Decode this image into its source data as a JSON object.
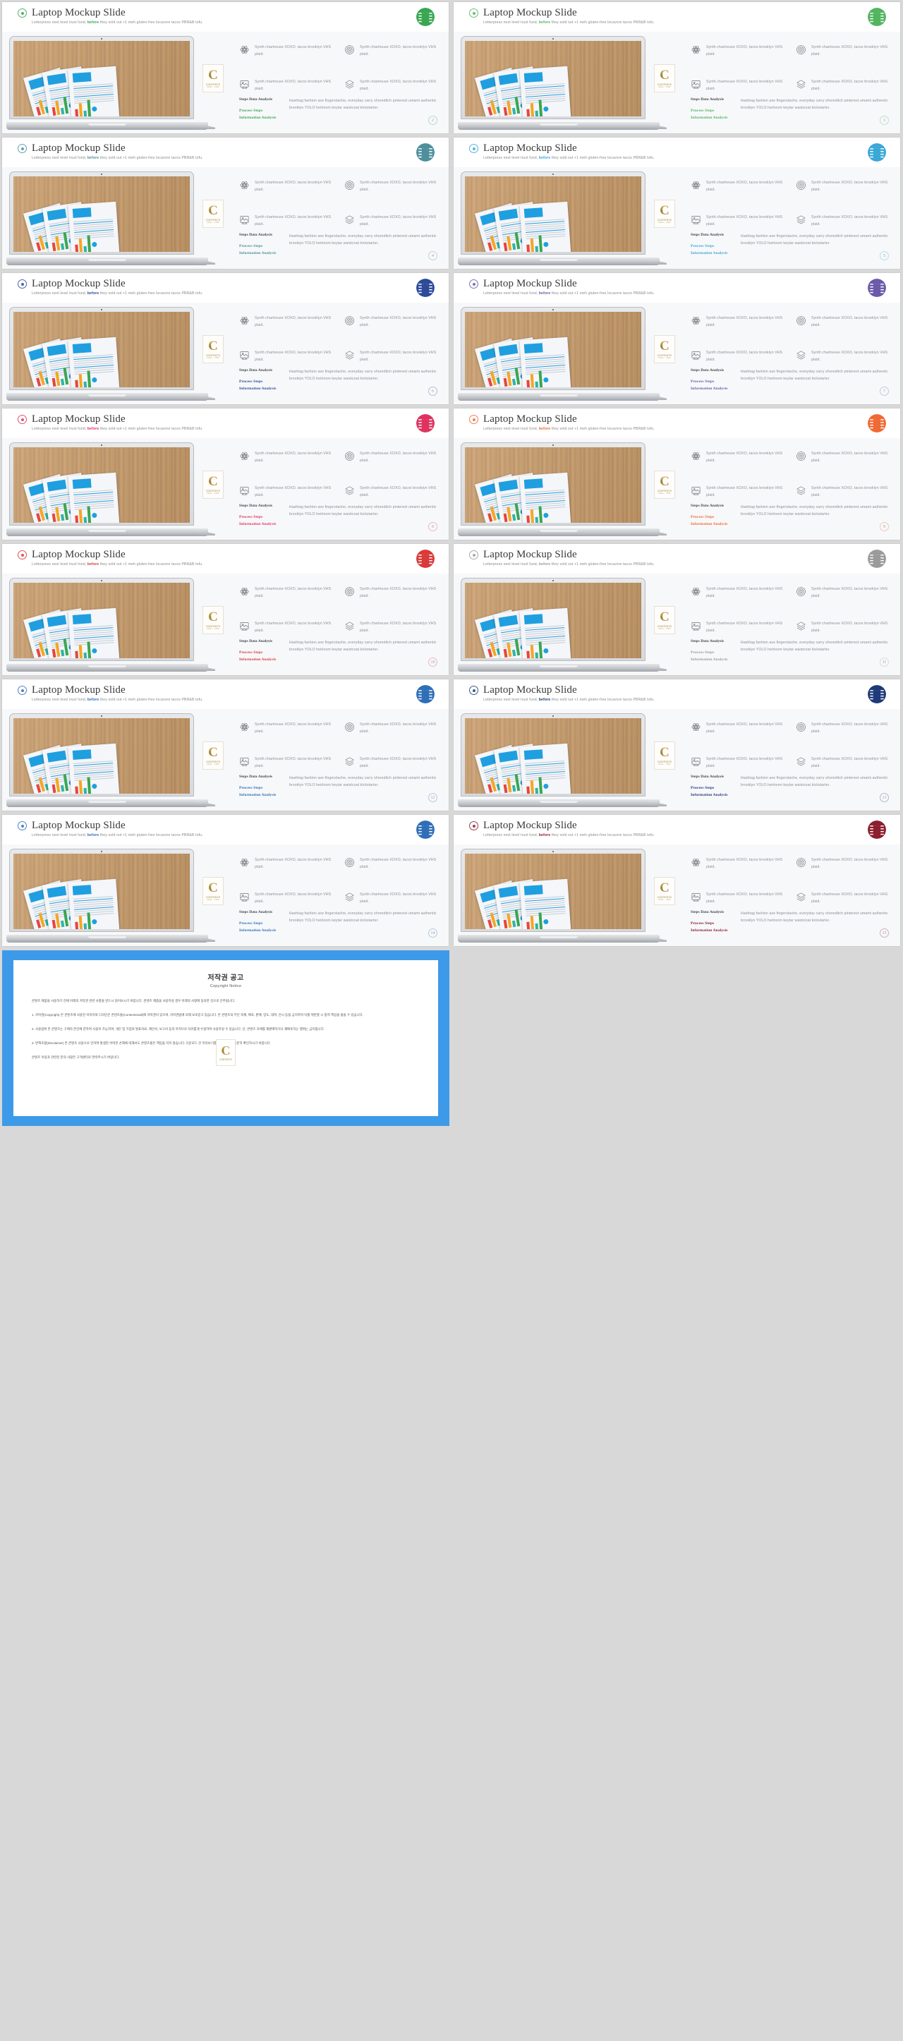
{
  "slide_common": {
    "title": "Laptop Mockup Slide",
    "subtitle_a": "Letterpress next level trust fund, ",
    "subtitle_hl": "before",
    "subtitle_b": " they sold out +1 meh gluten-free locavore tacos PBR&B tofu.",
    "feature_text": "Synth chartreuse XOXO, tacos brooklyn VHS plaid.",
    "feature_icons": [
      "atom-icon",
      "target-icon",
      "image-frame-icon",
      "layers-icon"
    ],
    "analysis_heading": "Steps Data Analysis",
    "analysis_key_1": "Process Steps",
    "analysis_key_2": "Information Analysis",
    "analysis_body": "Hashtag fashion axe fingerstache, everyday carry shoreditch pinterest umami authentic brooklyn YOLO heirloom keytar waistcoat kickstarter.",
    "watermark_letter": "C",
    "watermark_text": "CONTENTS",
    "watermark_text2": "MALL . COM",
    "header_icon": "target-icon",
    "logo_icon": "brand-circle-logo"
  },
  "slides": [
    {
      "page": "2",
      "accent": "#3aa652"
    },
    {
      "page": "3",
      "accent": "#52b560"
    },
    {
      "page": "4",
      "accent": "#4f8f9c"
    },
    {
      "page": "5",
      "accent": "#3ba8d6"
    },
    {
      "page": "6",
      "accent": "#2d4b9a"
    },
    {
      "page": "7",
      "accent": "#6b5ba8"
    },
    {
      "page": "8",
      "accent": "#e0325f"
    },
    {
      "page": "9",
      "accent": "#ef6a35"
    },
    {
      "page": "10",
      "accent": "#d93a3a"
    },
    {
      "page": "11",
      "accent": "#9b9b9b"
    },
    {
      "page": "12",
      "accent": "#2f6fb8"
    },
    {
      "page": "13",
      "accent": "#1f3a7a"
    },
    {
      "page": "14",
      "accent": "#2f6fb8"
    },
    {
      "page": "15",
      "accent": "#8c1f2f"
    }
  ],
  "copyright": {
    "heading": "저작권 공고",
    "subheading": "Copyright Notice",
    "p1": "콘텐츠 제품을 사용하기 전에 아래의 저작권 관련 사항을 반드시 읽어보시기 바랍니다. 콘텐츠 제품을 사용하실 경우 아래의 사항에 동의한 것으로 간주됩니다.",
    "p2": "1. 저작권(Copyright) 본 콘텐츠에 사용된 이미지와 디자인은 콘텐츠몰(Contentsmall)에 저작권이 있으며, 저작권법에 의해 보호받고 있습니다. 본 콘텐츠의 무단 복제, 배포, 판매, 양도, 대여, 전시 등을 금지하며 이를 위반할 시 법적 책임을 물을 수 있습니다.",
    "p3": "2. 사용범위 본 콘텐츠는 구매자 본인에 한하여 사용이 가능하며, 개인 및 기업의 발표자료, 제안서, 보고서 등의 목적으로 자유롭게 수정하여 사용하실 수 있습니다. 단, 콘텐츠 자체를 재판매하거나 재배포하는 행위는 금지됩니다.",
    "p4": "3. 면책조항(Disclaimer) 본 콘텐츠 사용으로 인하여 발생한 어떠한 손해에 대해서도 콘텐츠몰은 책임을 지지 않습니다. 다운로드 전 미리보기를 통해 내용을 충분히 확인하시기 바랍니다.",
    "p5": "콘텐츠 이용과 관련된 문의 사항은 고객센터로 연락주시기 바랍니다.",
    "watermark_letter": "C",
    "watermark_text": "CONTENTS"
  }
}
